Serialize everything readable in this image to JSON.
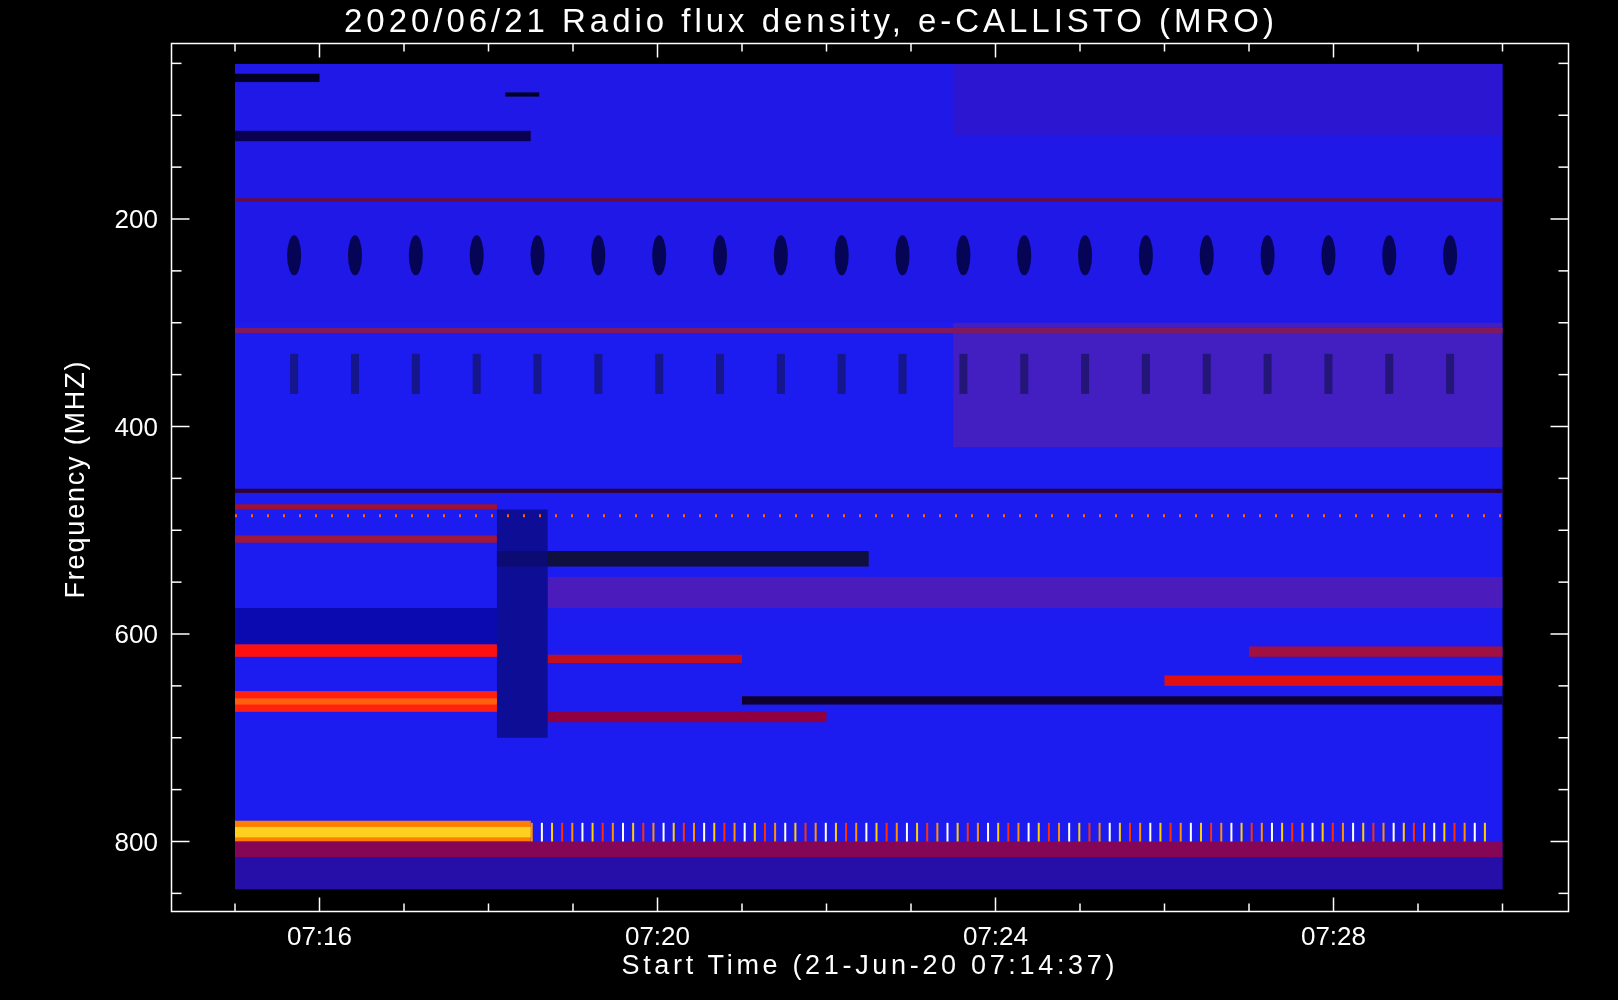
{
  "plot": {
    "title": "2020/06/21  Radio flux density, e-CALLISTO (MRO)",
    "y_axis": {
      "label": "Frequency (MHZ)",
      "ticks": [
        "200",
        "400",
        "600",
        "800"
      ]
    },
    "x_axis": {
      "label": "Start Time (21-Jun-20 07:14:37)",
      "ticks": [
        "07:16",
        "07:20",
        "07:24",
        "07:28"
      ]
    }
  }
}
